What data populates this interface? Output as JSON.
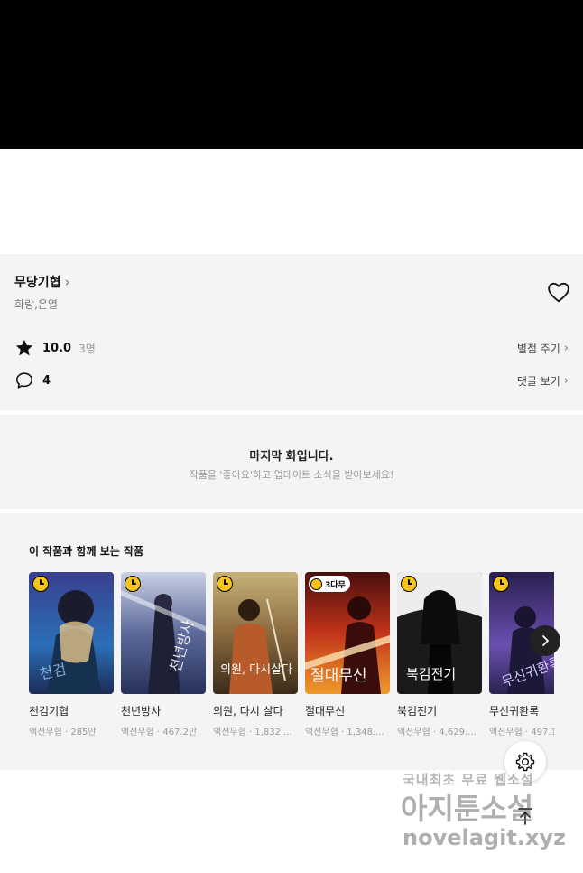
{
  "work": {
    "title": "무당기협",
    "authors": "화랑,은열"
  },
  "rating": {
    "score": "10.0",
    "votes": "3명",
    "rate_label": "별점 주기"
  },
  "comments": {
    "count": "4",
    "view_label": "댓글 보기"
  },
  "last_episode": {
    "title": "마지막 화입니다.",
    "subtitle": "작품을 '좋아요'하고 업데이트 소식을 받아보세요!"
  },
  "recommendations": {
    "heading": "이 작품과 함께 보는 작품",
    "items": [
      {
        "title": "천검기협",
        "meta": "액션무협 · 285만",
        "badge": "clock"
      },
      {
        "title": "천년방사",
        "meta": "액션무협 · 467.2만",
        "badge": "clock"
      },
      {
        "title": "의원, 다시 살다",
        "meta": "액션무협 · 1,832....",
        "badge": "clock"
      },
      {
        "title": "절대무신",
        "meta": "액션무협 · 1,348....",
        "badge": "3다무"
      },
      {
        "title": "북검전기",
        "meta": "액션무협 · 4,629....",
        "badge": "clock"
      },
      {
        "title": "무신귀환록",
        "meta": "액션무협 · 497.1",
        "badge": "clock"
      }
    ],
    "cover_texts": [
      "천검",
      "천년방사",
      "의원, 다시살다",
      "절대무신",
      "북검전기",
      "무신귀환록"
    ]
  },
  "watermark": {
    "line1": "국내최초 무료 웹소설",
    "line2": "아지툰소설",
    "line3": "novelagit.xyz"
  },
  "icons": {
    "heart": "heart-outline-icon",
    "star": "star-icon",
    "comment": "comment-bubble-icon",
    "next": "chevron-right-icon",
    "settings": "gear-icon",
    "top": "arrow-up-icon"
  },
  "colors": {
    "badge_yellow": "#f5c518",
    "panel_bg": "#f4f4f4"
  }
}
